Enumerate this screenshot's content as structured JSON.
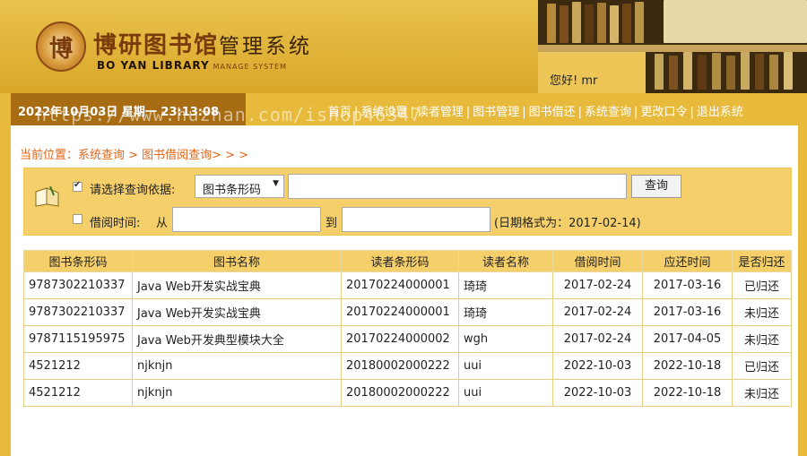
{
  "header": {
    "logo_seal_char": "博",
    "title_main": "博研图书馆",
    "title_sub": "管理系统",
    "title_en": "BO YAN LIBRARY",
    "title_en_sub": "MANAGE SYSTEM",
    "greeting": "您好!   mr"
  },
  "nav": {
    "datetime": "2022年10月03日 星期一 23:13:08",
    "items": [
      "首页",
      "系统设置",
      "读者管理",
      "图书管理",
      "图书借还",
      "系统查询",
      "更改口令",
      "退出系统"
    ],
    "watermark": "https://www.huzhan.com/ishop46347"
  },
  "breadcrumb": "当前位置：系统查询 > 图书借阅查询> > >",
  "search": {
    "criteria_label": "请选择查询依据:",
    "criteria_checked": true,
    "criteria_select": "图书条形码",
    "query_value": "",
    "query_button": "查询",
    "date_label": "借阅时间:",
    "date_checked": false,
    "from_label": "从",
    "from_value": "",
    "to_label": "到",
    "to_value": "",
    "date_hint": "(日期格式为：2017-02-14)"
  },
  "table": {
    "headers": [
      "图书条形码",
      "图书名称",
      "读者条形码",
      "读者名称",
      "借阅时间",
      "应还时间",
      "是否归还"
    ],
    "rows": [
      [
        "9787302210337",
        "Java Web开发实战宝典",
        "20170224000001",
        "琦琦",
        "2017-02-24",
        "2017-03-16",
        "已归还"
      ],
      [
        "9787302210337",
        "Java Web开发实战宝典",
        "20170224000001",
        "琦琦",
        "2017-02-24",
        "2017-03-16",
        "未归还"
      ],
      [
        "9787115195975",
        "Java Web开发典型模块大全",
        "20170224000002",
        "wgh",
        "2017-02-24",
        "2017-04-05",
        "未归还"
      ],
      [
        "4521212",
        "njknjn",
        "20180002000222",
        "uui",
        "2022-10-03",
        "2022-10-18",
        "已归还"
      ],
      [
        "4521212",
        "njknjn",
        "20180002000222",
        "uui",
        "2022-10-03",
        "2022-10-18",
        "未归还"
      ]
    ]
  },
  "colors": {
    "header_gold": "#e9c24c",
    "nav_gold": "#e7ba3b",
    "date_brown": "#a86c12",
    "crumb_orange": "#e0661a",
    "panel_yellow": "#f5cf6a"
  }
}
